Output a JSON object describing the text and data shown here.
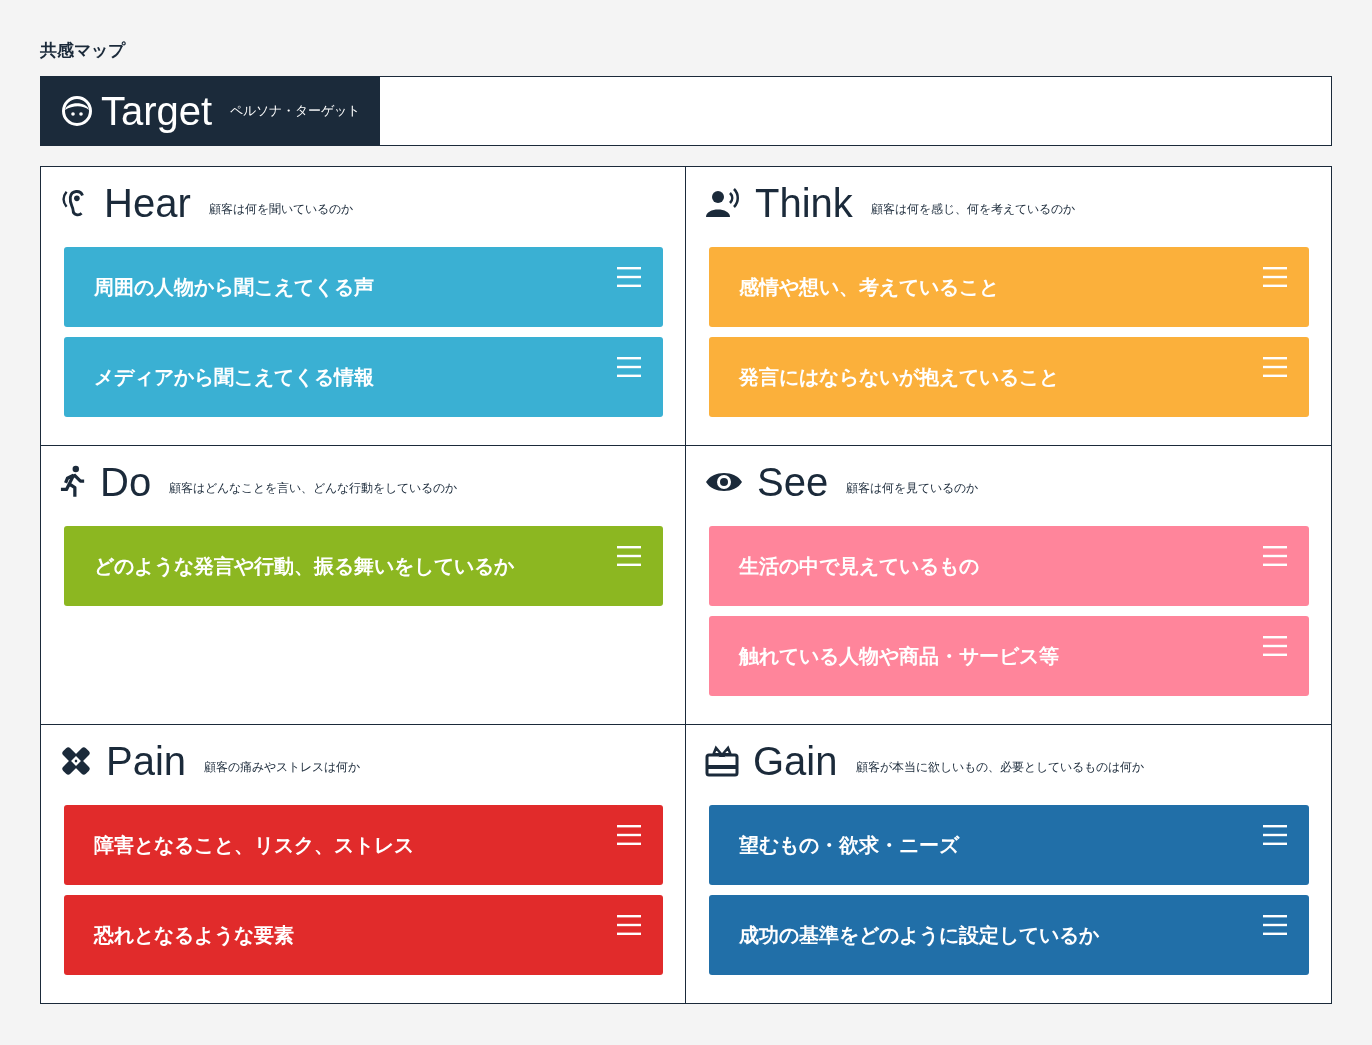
{
  "page_title": "共感マップ",
  "target": {
    "title": "Target",
    "subtitle": "ペルソナ・ターゲット"
  },
  "sections": [
    {
      "kind": "hear",
      "title": "Hear",
      "subtitle": "顧客は何を聞いているのか",
      "color": "#3ab0d3",
      "cards": [
        "周囲の人物から聞こえてくる声",
        "メディアから聞こえてくる情報"
      ]
    },
    {
      "kind": "think",
      "title": "Think",
      "subtitle": "顧客は何を感じ、何を考えているのか",
      "color": "#fbb03b",
      "cards": [
        "感情や想い、考えていること",
        "発言にはならないが抱えていること"
      ]
    },
    {
      "kind": "do",
      "title": "Do",
      "subtitle": "顧客はどんなことを言い、どんな行動をしているのか",
      "color": "#8cb721",
      "cards": [
        "どのような発言や行動、振る舞いをしているか"
      ]
    },
    {
      "kind": "see",
      "title": "See",
      "subtitle": "顧客は何を見ているのか",
      "color": "#ff859b",
      "cards": [
        "生活の中で見えているもの",
        "触れている人物や商品・サービス等"
      ]
    },
    {
      "kind": "pain",
      "title": "Pain",
      "subtitle": "顧客の痛みやストレスは何か",
      "color": "#e12b2b",
      "cards": [
        "障害となること、リスク、ストレス",
        "恐れとなるような要素"
      ]
    },
    {
      "kind": "gain",
      "title": "Gain",
      "subtitle": "顧客が本当に欲しいもの、必要としているものは何か",
      "color": "#216fa8",
      "cards": [
        "望むもの・欲求・ニーズ",
        "成功の基準をどのように設定しているか"
      ]
    }
  ]
}
